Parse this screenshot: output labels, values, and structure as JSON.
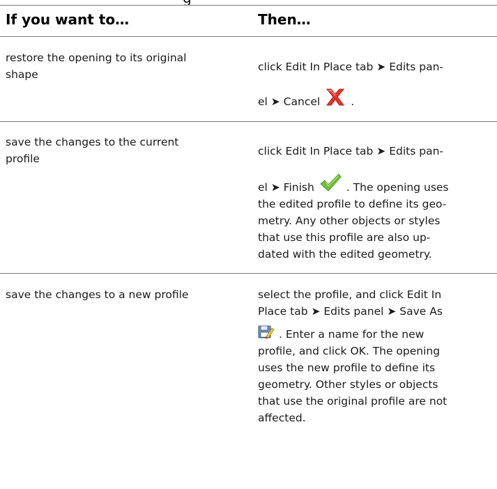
{
  "table": {
    "header": {
      "col1": "If you want to…",
      "col2": "Then…"
    },
    "rows": [
      {
        "want": [
          "restore the opening to its original",
          "shape"
        ],
        "then_before": [
          "click Edit In Place tab ➤ Edits pan-"
        ],
        "then_icon_line_before": "el ➤ Cancel",
        "icon": "cancel-x-icon",
        "then_icon_line_after": ".",
        "then_after": []
      },
      {
        "want": [
          "save the changes to the current",
          "profile"
        ],
        "then_before": [
          "click Edit In Place tab ➤ Edits pan-"
        ],
        "then_icon_line_before": "el ➤ Finish",
        "icon": "finish-check-icon",
        "then_icon_line_after": ". The opening uses",
        "then_after": [
          "the edited profile to define its geo-",
          "metry. Any other objects or styles",
          "that use this profile are also up-",
          "dated with the edited geometry."
        ]
      },
      {
        "want": [
          "save the changes to a new profile"
        ],
        "then_before": [
          "select the profile, and click Edit In",
          "Place tab ➤ Edits panel ➤ Save As"
        ],
        "then_icon_line_before": "",
        "icon": "save-as-icon",
        "then_icon_line_after": ". Enter a name for the new",
        "then_after": [
          "profile, and click OK. The opening",
          "uses the new profile to define its",
          "geometry. Other styles or objects",
          "that use the original profile are not",
          "affected."
        ]
      }
    ]
  },
  "colors": {
    "rule": "#7a7a7a",
    "cancel_red": "#e0342c",
    "finish_green": "#6fbf3b",
    "text": "#1a1a1a"
  }
}
